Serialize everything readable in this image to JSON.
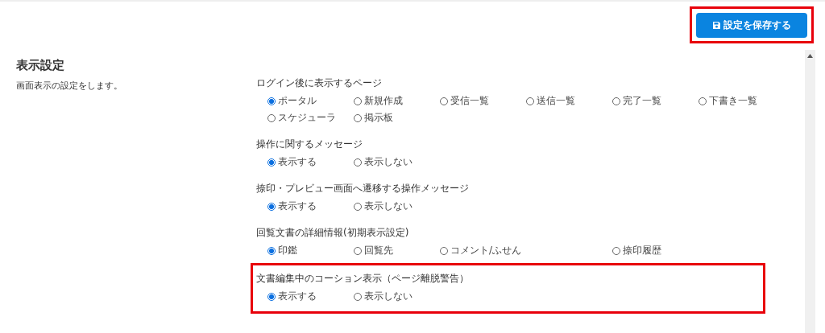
{
  "save_button": {
    "label": "設定を保存する",
    "highlighted": true
  },
  "section": {
    "title": "表示設定",
    "description": "画面表示の設定をします。"
  },
  "groups": [
    {
      "label": "ログイン後に表示するページ",
      "highlighted": false,
      "options": [
        {
          "label": "ポータル",
          "selected": true
        },
        {
          "label": "新規作成",
          "selected": false
        },
        {
          "label": "受信一覧",
          "selected": false
        },
        {
          "label": "送信一覧",
          "selected": false
        },
        {
          "label": "完了一覧",
          "selected": false
        },
        {
          "label": "下書き一覧",
          "selected": false
        },
        {
          "label": "スケジューラ",
          "selected": false
        },
        {
          "label": "掲示板",
          "selected": false
        }
      ]
    },
    {
      "label": "操作に関するメッセージ",
      "highlighted": false,
      "options": [
        {
          "label": "表示する",
          "selected": true
        },
        {
          "label": "表示しない",
          "selected": false
        }
      ]
    },
    {
      "label": "捺印・プレビュー画面へ遷移する操作メッセージ",
      "highlighted": false,
      "options": [
        {
          "label": "表示する",
          "selected": true
        },
        {
          "label": "表示しない",
          "selected": false
        }
      ]
    },
    {
      "label": "回覧文書の詳細情報(初期表示設定)",
      "highlighted": false,
      "options": [
        {
          "label": "印鑑",
          "selected": true
        },
        {
          "label": "回覧先",
          "selected": false
        },
        {
          "label": "コメント/ふせん",
          "selected": false
        },
        {
          "label": "捺印履歴",
          "selected": false
        }
      ]
    },
    {
      "label": "文書編集中のコーション表示（ページ離脱警告）",
      "highlighted": true,
      "options": [
        {
          "label": "表示する",
          "selected": true
        },
        {
          "label": "表示しない",
          "selected": false
        }
      ]
    }
  ]
}
